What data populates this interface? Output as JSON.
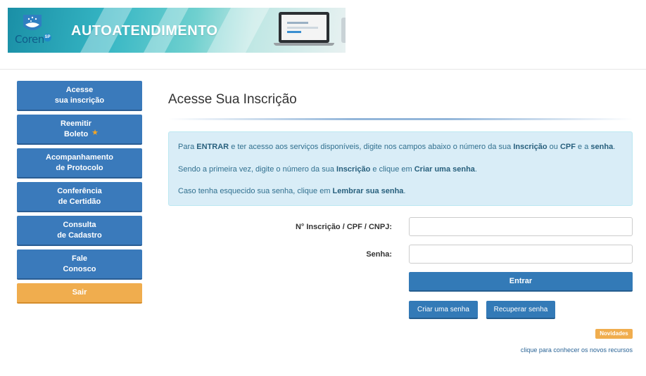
{
  "banner": {
    "title": "AUTOATENDIMENTO",
    "brand_prefix": "Cor",
    "brand_suffix": "en",
    "brand_badge": "SP"
  },
  "sidebar": {
    "items": [
      {
        "label": "Acesse\nsua inscrição"
      },
      {
        "label": "Reemitir\nBoleto",
        "icon": "star-icon"
      },
      {
        "label": "Acompanhamento\nde Protocolo"
      },
      {
        "label": "Conferência\nde Certidão"
      },
      {
        "label": "Consulta\nde Cadastro"
      },
      {
        "label": "Fale\nConosco"
      },
      {
        "label": "Sair",
        "color": "#f0ad4e"
      }
    ]
  },
  "main": {
    "title": "Acesse Sua Inscrição",
    "info": {
      "line1_a": "Para ",
      "line1_b": "ENTRAR",
      "line1_c": " e ter acesso aos serviços disponíveis, digite nos campos abaixo o número da sua ",
      "line1_d": "Inscrição",
      "line1_e": " ou ",
      "line1_f": "CPF",
      "line1_g": " e a ",
      "line1_h": "senha",
      "line1_i": ".",
      "line2_a": "Sendo a primeira vez, digite o número da sua ",
      "line2_b": "Inscrição",
      "line2_c": " e clique em ",
      "line2_d": "Criar uma senha",
      "line2_e": ".",
      "line3_a": "Caso tenha esquecido sua senha, clique em ",
      "line3_b": "Lembrar sua senha",
      "line3_c": "."
    },
    "form": {
      "login_label": "N° Inscrição / CPF / CNPJ:",
      "login_value": "",
      "password_label": "Senha:",
      "password_value": ""
    },
    "buttons": {
      "entrar": "Entrar",
      "criar": "Criar uma senha",
      "recuperar": "Recuperar senha"
    },
    "badge": "Novidades",
    "news_link": "clique para conhecer os novos recursos"
  },
  "colors": {
    "primary": "#337ab7",
    "warning": "#f0ad4e",
    "info_bg": "#d9edf7",
    "info_text": "#31708f"
  }
}
